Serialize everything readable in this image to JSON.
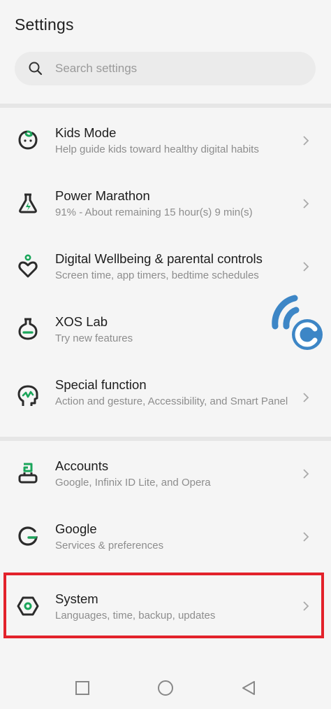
{
  "header": {
    "title": "Settings"
  },
  "search": {
    "placeholder": "Search settings",
    "icon": "search-icon"
  },
  "sections": [
    {
      "items": [
        {
          "title": "Kids Mode",
          "subtitle": "Help guide kids toward healthy digital habits",
          "icon": "kids-mode-icon"
        },
        {
          "title": "Power Marathon",
          "subtitle": "91% - About remaining 15 hour(s)  9 min(s)",
          "icon": "power-marathon-icon"
        },
        {
          "title": "Digital Wellbeing & parental controls",
          "subtitle": "Screen time, app timers, bedtime schedules",
          "icon": "digital-wellbeing-icon"
        },
        {
          "title": "XOS Lab",
          "subtitle": "Try new features",
          "icon": "xos-lab-icon"
        },
        {
          "title": "Special function",
          "subtitle": "Action and gesture, Accessibility, and Smart Panel",
          "icon": "special-function-icon"
        }
      ]
    },
    {
      "items": [
        {
          "title": "Accounts",
          "subtitle": "Google, Infinix ID Lite, and Opera",
          "icon": "accounts-icon"
        },
        {
          "title": "Google",
          "subtitle": "Services & preferences",
          "icon": "google-icon"
        },
        {
          "title": "System",
          "subtitle": "Languages, time, backup, updates",
          "icon": "system-icon",
          "highlighted": true
        }
      ]
    }
  ],
  "colors": {
    "accent_green": "#1aa55a",
    "icon_dark": "#2b2b2b",
    "highlight_red": "#e3222b",
    "watermark_blue": "#3d86c6"
  },
  "navbar": {
    "buttons": [
      "recents-button",
      "home-button",
      "back-button"
    ]
  }
}
